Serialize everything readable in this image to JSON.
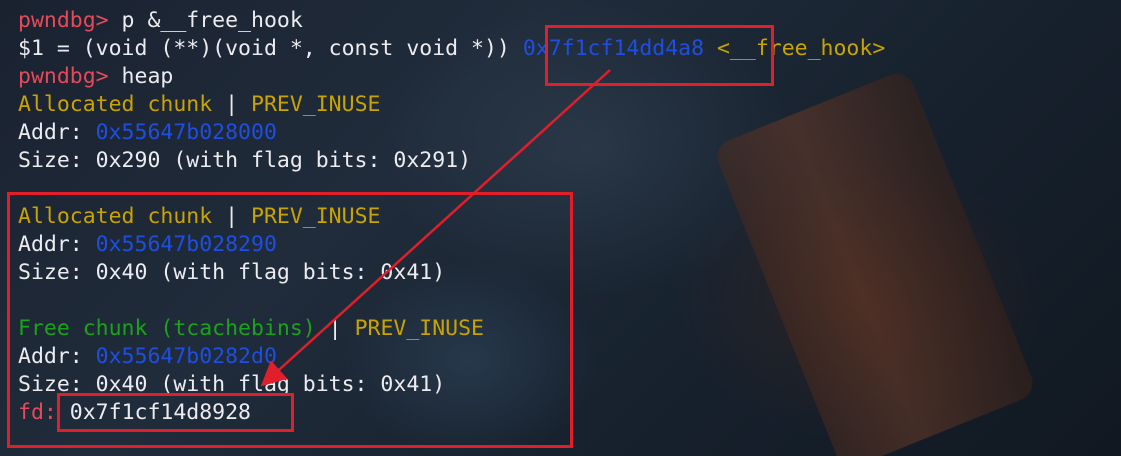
{
  "terminal": {
    "line1": {
      "prompt": "pwndbg>",
      "command": " p &__free_hook"
    },
    "line2": {
      "prefix": "$1 = (void (**)(void *, const void *)) ",
      "address": "0x7f1cf14dd4a8",
      "symbol": " <__free_hook>"
    },
    "line3": {
      "prompt": "pwndbg>",
      "command": " heap"
    },
    "chunks": [
      {
        "status": "Allocated chunk",
        "separator": " | ",
        "flag": "PREV_INUSE",
        "addr_label": "Addr: ",
        "addr": "0x55647b028000",
        "size_text": "Size: 0x290 (with flag bits: 0x291)"
      },
      {
        "status": "Allocated chunk",
        "separator": " | ",
        "flag": "PREV_INUSE",
        "addr_label": "Addr: ",
        "addr": "0x55647b028290",
        "size_text": "Size: 0x40 (with flag bits: 0x41)"
      },
      {
        "status": "Free chunk (tcachebins)",
        "separator": " | ",
        "flag": "PREV_INUSE",
        "addr_label": "Addr: ",
        "addr": "0x55647b0282d0",
        "size_text": "Size: 0x40 (with flag bits: 0x41)",
        "fd_label": "fd:",
        "fd_value": " 0x7f1cf14d8928"
      }
    ]
  },
  "colors": {
    "prompt": "#e64a5a",
    "yellow": "#c9a400",
    "blue": "#1f4fe0",
    "green": "#1aa31a",
    "highlight_box": "#e01f2a"
  }
}
